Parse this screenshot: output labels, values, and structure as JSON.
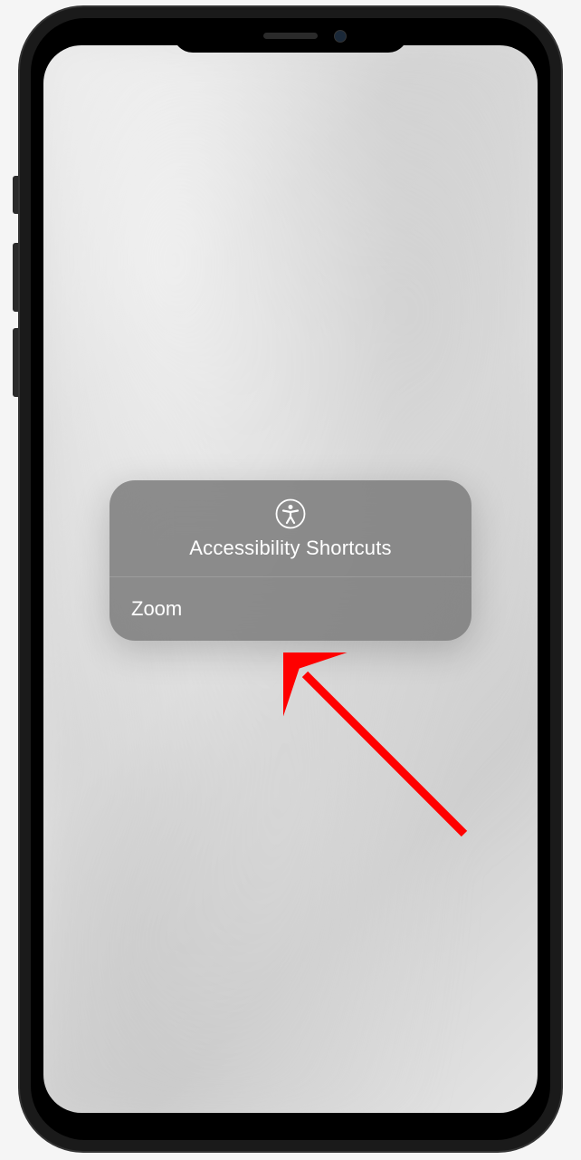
{
  "popup": {
    "title": "Accessibility Shortcuts",
    "icon": "accessibility-icon",
    "items": [
      {
        "label": "Zoom"
      }
    ]
  },
  "annotation": {
    "type": "arrow",
    "color": "#ff0000"
  }
}
